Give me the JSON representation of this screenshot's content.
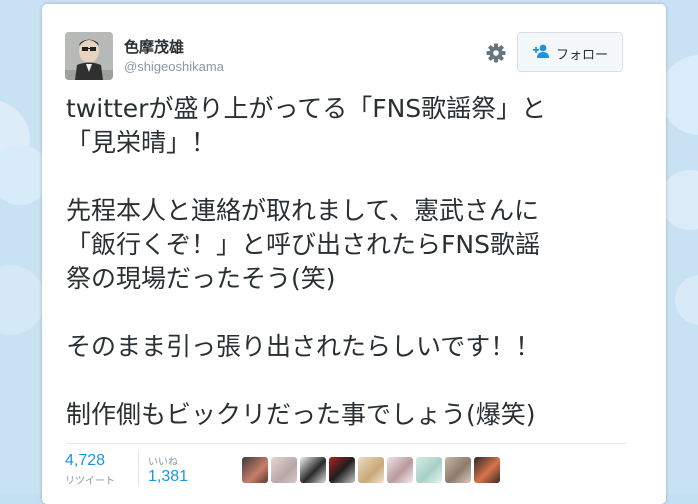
{
  "user": {
    "display_name": "色摩茂雄",
    "handle": "@shigeoshikama"
  },
  "header": {
    "follow_label": "フォロー",
    "settings_icon": "gear-icon",
    "follow_icon": "add-user-icon"
  },
  "tweet": {
    "lines": [
      "twitterが盛り上がってる「FNS歌謡祭」と",
      "「見栄晴」！",
      "先程本人と連絡が取れまして、憲武さんに",
      "「飯行くぞ！」と呼び出されたらFNS歌謡",
      "祭の現場だったそう(笑)",
      "そのまま引っ張り出されたらしいです！！",
      "制作側もビックリだった事でしょう(爆笑)"
    ]
  },
  "stats": {
    "retweets": {
      "count": "4,728",
      "label": "リツイート"
    },
    "likes": {
      "count": "1,381",
      "label": "いいね"
    }
  },
  "colors": {
    "link_blue": "#1b95e0",
    "text": "#292f33",
    "muted": "#8899a6",
    "background_sky": "#c3dff2"
  }
}
